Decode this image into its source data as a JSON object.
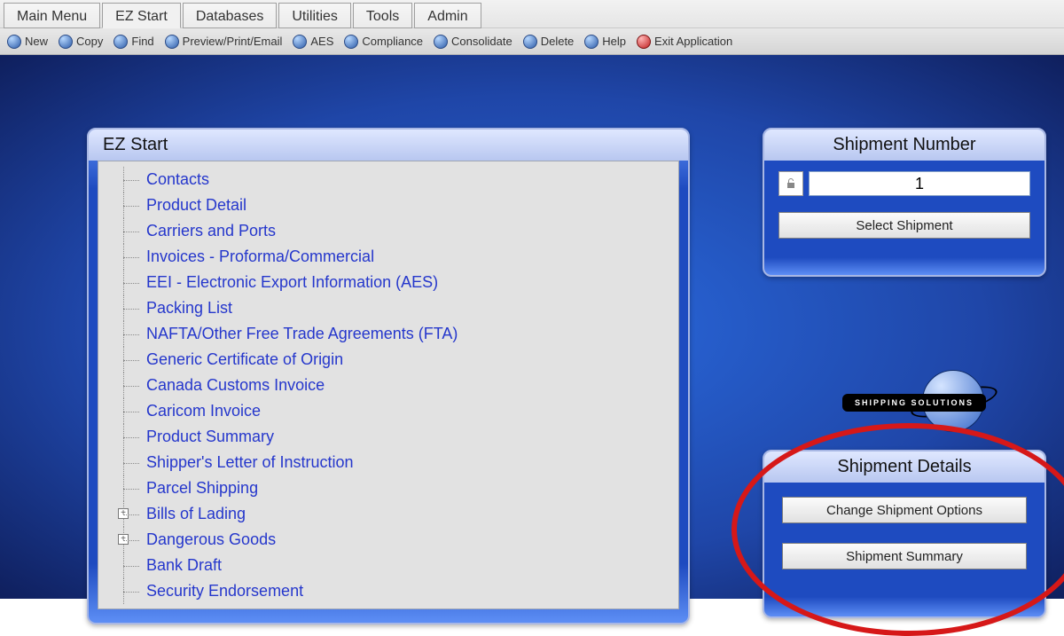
{
  "menu": {
    "tabs": [
      "Main Menu",
      "EZ Start",
      "Databases",
      "Utilities",
      "Tools",
      "Admin"
    ],
    "active_index": 1
  },
  "toolbar": [
    {
      "label": "New",
      "icon": "blue"
    },
    {
      "label": "Copy",
      "icon": "blue"
    },
    {
      "label": "Find",
      "icon": "blue"
    },
    {
      "label": "Preview/Print/Email",
      "icon": "blue"
    },
    {
      "label": "AES",
      "icon": "blue"
    },
    {
      "label": "Compliance",
      "icon": "blue"
    },
    {
      "label": "Consolidate",
      "icon": "blue"
    },
    {
      "label": "Delete",
      "icon": "blue"
    },
    {
      "label": "Help",
      "icon": "blue"
    },
    {
      "label": "Exit Application",
      "icon": "red"
    }
  ],
  "ez_start": {
    "title": "EZ Start",
    "items": [
      {
        "label": "Contacts",
        "expandable": false
      },
      {
        "label": "Product Detail",
        "expandable": false
      },
      {
        "label": "Carriers and Ports",
        "expandable": false
      },
      {
        "label": "Invoices - Proforma/Commercial",
        "expandable": false
      },
      {
        "label": "EEI - Electronic Export Information (AES)",
        "expandable": false
      },
      {
        "label": "Packing List",
        "expandable": false
      },
      {
        "label": "NAFTA/Other Free Trade Agreements (FTA)",
        "expandable": false
      },
      {
        "label": "Generic Certificate of Origin",
        "expandable": false
      },
      {
        "label": "Canada Customs Invoice",
        "expandable": false
      },
      {
        "label": "Caricom Invoice",
        "expandable": false
      },
      {
        "label": "Product Summary",
        "expandable": false
      },
      {
        "label": "Shipper's Letter of Instruction",
        "expandable": false
      },
      {
        "label": "Parcel Shipping",
        "expandable": false
      },
      {
        "label": "Bills of Lading",
        "expandable": true
      },
      {
        "label": "Dangerous Goods",
        "expandable": true
      },
      {
        "label": "Bank Draft",
        "expandable": false
      },
      {
        "label": "Security Endorsement",
        "expandable": false
      }
    ]
  },
  "shipment_number": {
    "title": "Shipment Number",
    "value": "1",
    "select_button": "Select Shipment"
  },
  "shipment_details": {
    "title": "Shipment Details",
    "change_button": "Change Shipment Options",
    "summary_button": "Shipment Summary"
  },
  "logo": {
    "text": "SHIPPING SOLUTIONS"
  }
}
